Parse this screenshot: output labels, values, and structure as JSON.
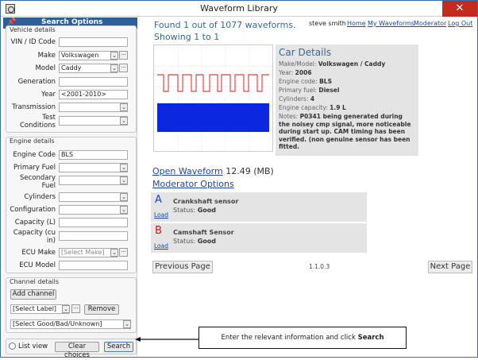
{
  "window": {
    "title": "Waveform Library",
    "close_glyph": "✕"
  },
  "search_panel": {
    "title": "Search Options",
    "vehicle_details": {
      "title": "Vehicle details",
      "vin_label": "VIN / ID Code",
      "vin_value": "",
      "make_label": "Make",
      "make_value": "Volkswagen",
      "model_label": "Model",
      "model_value": "Caddy",
      "generation_label": "Generation",
      "generation_value": "",
      "year_label": "Year",
      "year_value": "<2001-2010>",
      "transmission_label": "Transmission",
      "transmission_value": "",
      "test_conditions_label": "Test Conditions",
      "test_conditions_value": ""
    },
    "engine_details": {
      "title": "Engine details",
      "engine_code_label": "Engine Code",
      "engine_code_value": "BLS",
      "primary_fuel_label": "Primary Fuel",
      "primary_fuel_value": "",
      "secondary_fuel_label": "Secondary Fuel",
      "secondary_fuel_value": "",
      "cylinders_label": "Cylinders",
      "cylinders_value": "",
      "configuration_label": "Configuration",
      "configuration_value": "",
      "capacity_l_label": "Capacity (L)",
      "capacity_l_value": "",
      "capacity_cu_label": "Capacity (cu in)",
      "capacity_cu_value": "",
      "ecu_make_label": "ECU Make",
      "ecu_make_placeholder": "[Select Make]",
      "ecu_model_label": "ECU Model",
      "ecu_model_value": ""
    },
    "channel_details": {
      "title": "Channel details",
      "add_channel": "Add channel",
      "select_label": "[Select Label]",
      "remove": "Remove",
      "status_select": "[Select Good/Bad/Unknown]"
    },
    "list_view": "List view",
    "clear_choices": "Clear choices",
    "search": "Search"
  },
  "results": {
    "found_line": "Found 1 out of 1077 waveforms.",
    "showing_line": "Showing 1 to 1",
    "user": "steve smith",
    "home": "Home",
    "my_waveforms": "My Waveforms",
    "moderator": "Moderator",
    "logout": "Log Out",
    "car": {
      "heading": "Car Details",
      "make_model_label": "Make/Model:",
      "make_model": "Volkswagen / Caddy",
      "year_label": "Year:",
      "year": "2006",
      "engine_code_label": "Engine code:",
      "engine_code": "BLS",
      "primary_fuel_label": "Primary fuel:",
      "primary_fuel": "Diesel",
      "cylinders_label": "Cylinders:",
      "cylinders": "4",
      "engine_capacity_label": "Engine capacity:",
      "engine_capacity": "1.9 L",
      "notes_label": "Notes:",
      "notes": "P0341 being generated during the noisey cmp signal, more noticeable during start up. CAM timing has been verified. (non genuine sensor has been fitted."
    },
    "open_waveform": "Open Waveform",
    "file_size": "12.49 (MB)",
    "moderator_options": "Moderator Options",
    "channels": [
      {
        "letter": "A",
        "color": "#1c3fc4",
        "load": "Load",
        "name": "Crankshaft sensor",
        "status_label": "Status:",
        "status": "Good"
      },
      {
        "letter": "B",
        "color": "#d01818",
        "load": "Load",
        "name": "Camshaft Sensor",
        "status_label": "Status:",
        "status": "Good"
      }
    ],
    "previous_page": "Previous Page",
    "version": "1.1.0.3",
    "next_page": "Next Page"
  },
  "callout": {
    "text_prefix": "Enter the relevant information  and click ",
    "text_bold": "Search"
  }
}
